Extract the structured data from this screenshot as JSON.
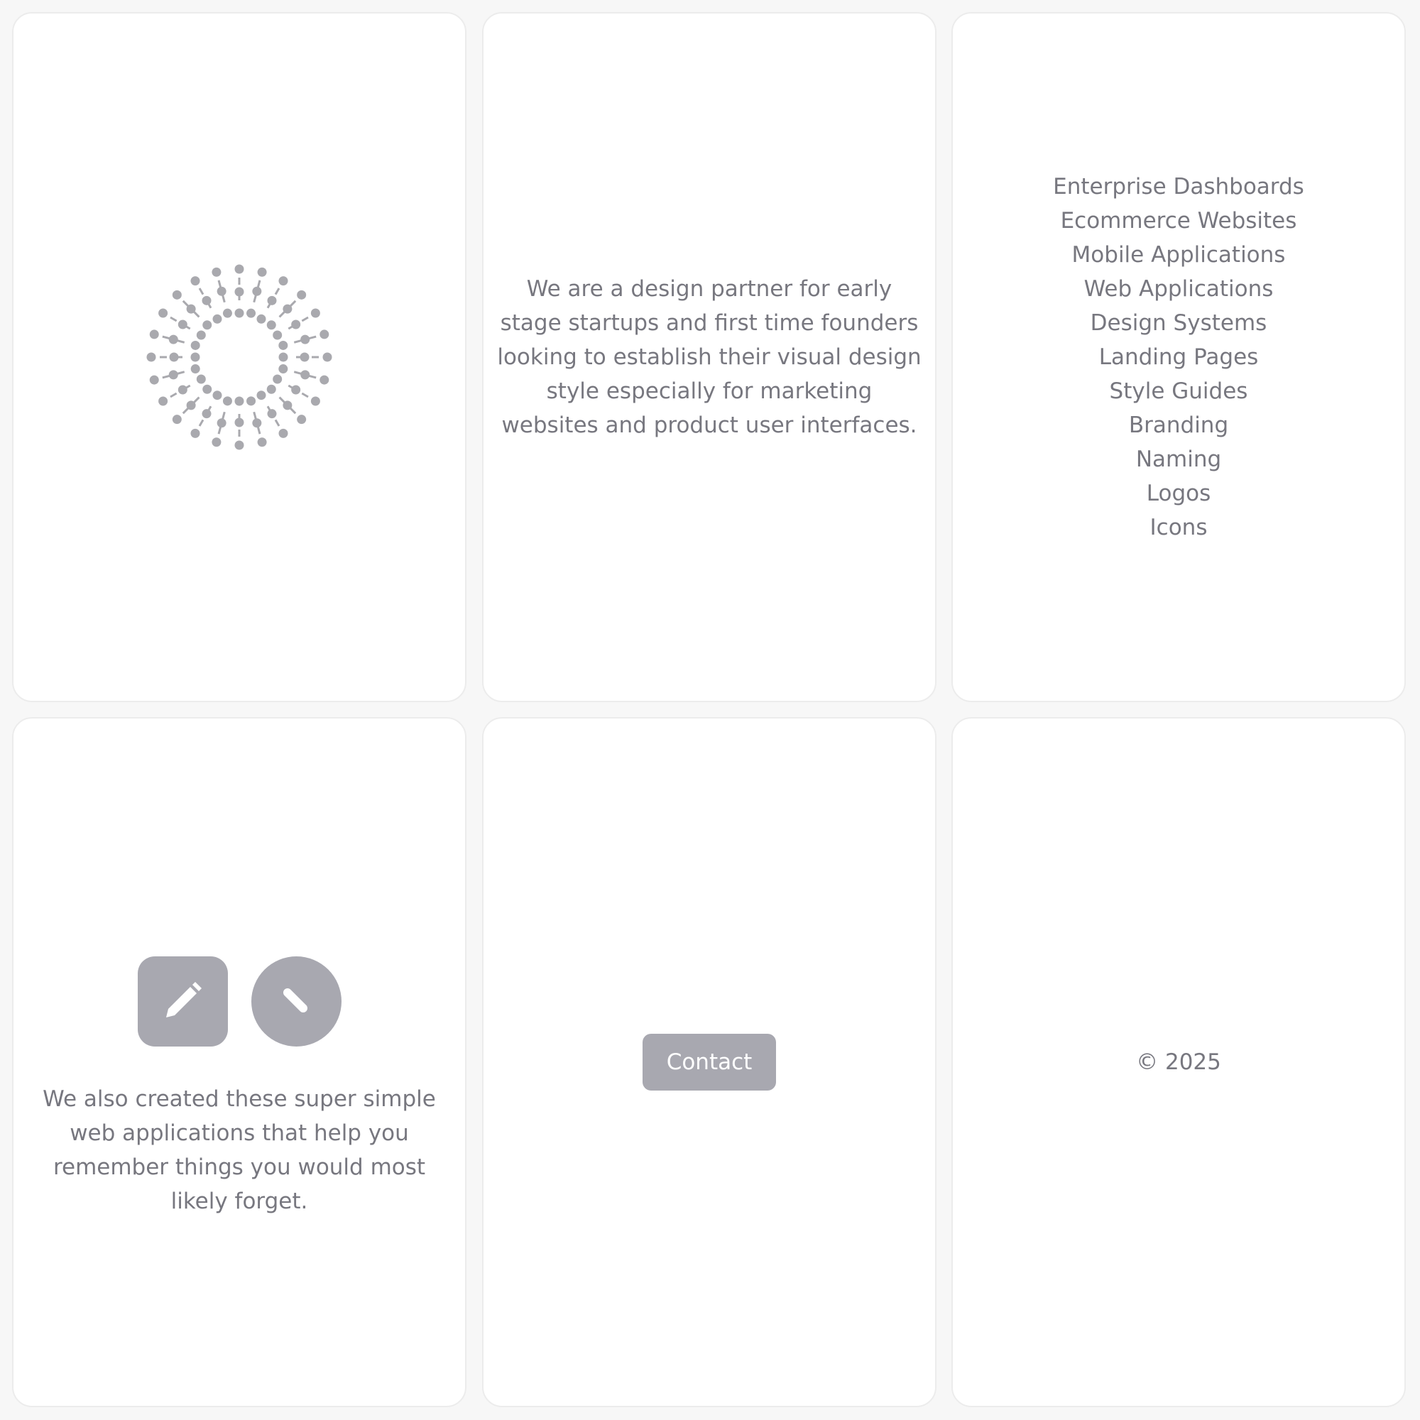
{
  "intro": {
    "text": "We are a design partner for early stage startups and first time founders looking to establish their visual design style especially for marketing websites and product user interfaces."
  },
  "services": {
    "items": [
      "Enterprise Dashboards",
      "Ecommerce Websites",
      "Mobile Applications",
      "Web Applications",
      "Design Systems",
      "Landing Pages",
      "Style Guides",
      "Branding",
      "Naming",
      "Logos",
      "Icons"
    ]
  },
  "apps": {
    "icons": [
      "pencil-icon",
      "slash-icon"
    ],
    "text": "We also created these super simple web applications that help you remember things you would most likely forget."
  },
  "contact": {
    "button_label": "Contact"
  },
  "footer": {
    "copyright": "© 2025"
  },
  "colors": {
    "page_background": "#f7f7f7",
    "card_background": "#ffffff",
    "text": "#77777f",
    "accent_gray": "#a8a8b0",
    "logo_gray": "#a9a9ae"
  },
  "logo": {
    "icon": "radial-dots-logo"
  }
}
